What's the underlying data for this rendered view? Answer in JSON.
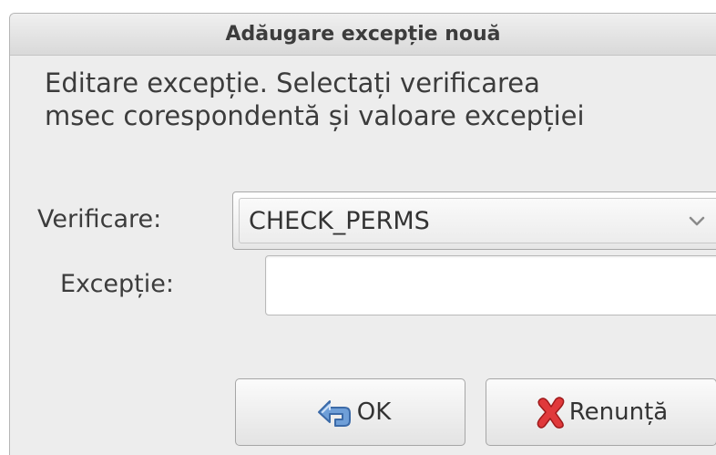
{
  "window": {
    "title": "Adăugare excepție nouă"
  },
  "description": "Editare excepție. Selectați verificarea\nmsec corespondentă și valoare excepției",
  "form": {
    "check_label": "Verificare:",
    "check_value": "CHECK_PERMS",
    "exception_label": "Excepție:",
    "exception_value": ""
  },
  "buttons": {
    "ok_label": "OK",
    "ok_icon": "undo-arrow-icon",
    "cancel_label": "Renunță",
    "cancel_icon": "red-x-icon"
  },
  "colors": {
    "ok_icon": "#4a7fc1",
    "cancel_icon": "#d0292a"
  }
}
